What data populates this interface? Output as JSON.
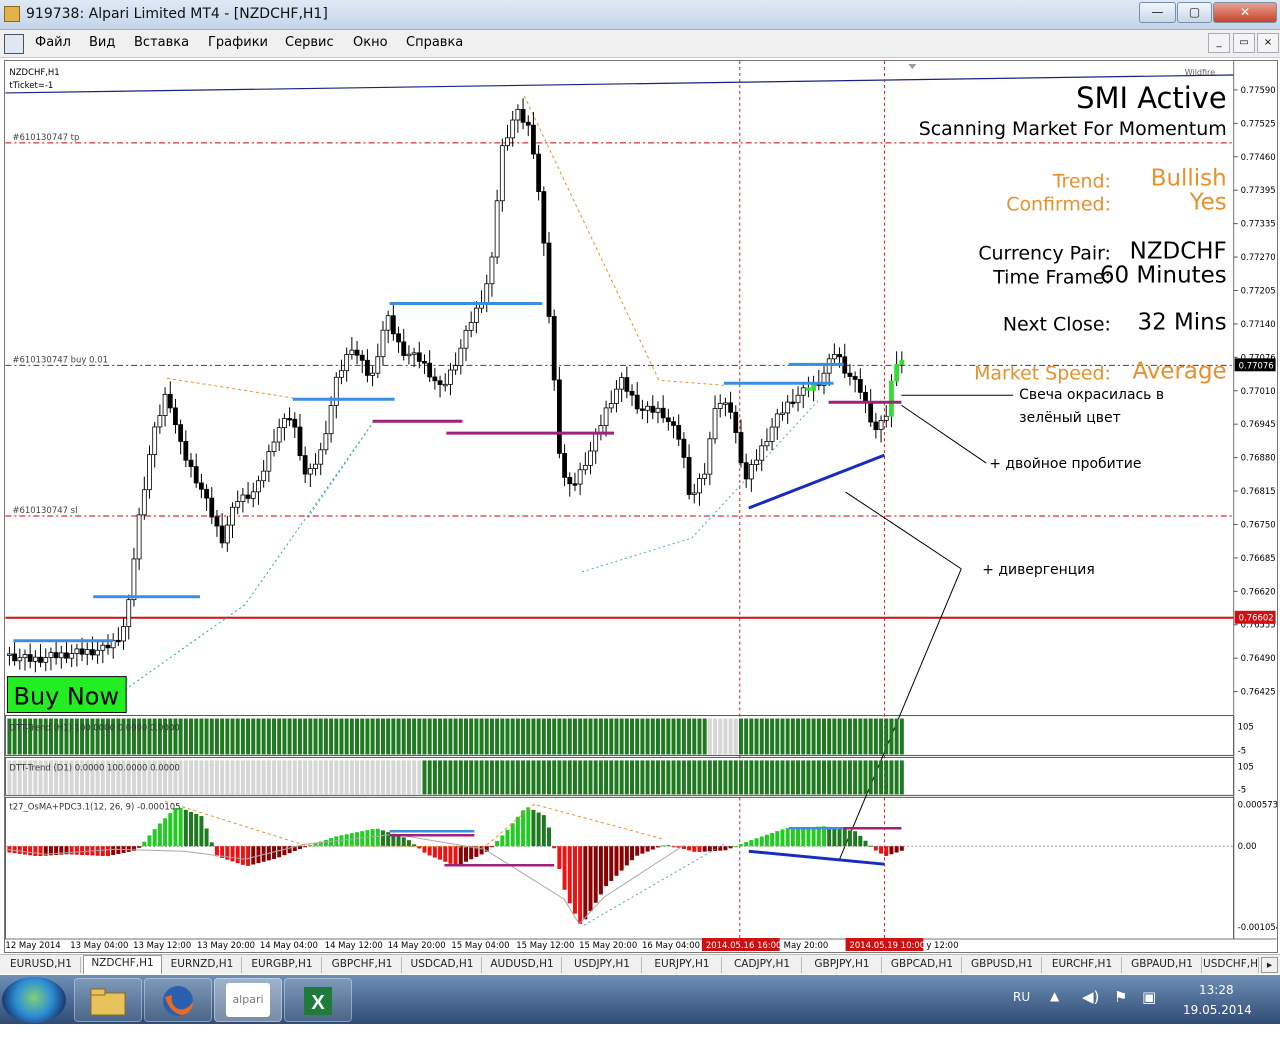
{
  "window": {
    "title": "919738: Alpari Limited MT4 - [NZDCHF,H1]",
    "min": "—",
    "max": "▢",
    "close": "✕"
  },
  "menu": [
    "Файл",
    "Вид",
    "Вставка",
    "Графики",
    "Сервис",
    "Окно",
    "Справка"
  ],
  "mdi": {
    "min": "_",
    "restore": "▭",
    "close": "×"
  },
  "chart": {
    "symbol": "NZDCHF,H1",
    "ticket": "tTicket=-1",
    "wildfire": "Wildfire",
    "lines": {
      "tp": "#610130747 tp",
      "buy": "#610130747 buy 0.01",
      "sl": "#610130747 sl"
    },
    "price_axis": [
      "0.77590",
      "0.77525",
      "0.77460",
      "0.77395",
      "0.77335",
      "0.77270",
      "0.77205",
      "0.77140",
      "0.77076",
      "0.77010",
      "0.76945",
      "0.76880",
      "0.76815",
      "0.76750",
      "0.76685",
      "0.76620",
      "0.76555",
      "0.76490",
      "0.76425"
    ],
    "current_price": "0.77076",
    "level_price": "0.76602",
    "smi": {
      "title": "SMI Active",
      "subtitle": "Scanning Market For Momentum",
      "trend_label": "Trend:",
      "trend_value": "Bullish",
      "confirmed_label": "Confirmed:",
      "confirmed_value": "Yes",
      "pair_label": "Currency Pair:",
      "pair_value": "NZDCHF",
      "tf_label": "Time Frame:",
      "tf_value": "60 Minutes",
      "close_label": "Next Close:",
      "close_value": "32 Mins",
      "speed_label": "Market Speed:",
      "speed_value": "Average"
    },
    "buy_now": "Buy Now",
    "notes": {
      "candle_1": "Свеча окрасилась в",
      "candle_2": "зелёный цвет",
      "double": "+ двойное пробитие",
      "divergence": "+ дивергенция"
    },
    "ind1": {
      "label": "DTT-Trend (H1) 100.0000 0.0000 0.0000",
      "max": "105",
      "min": "-5"
    },
    "ind2": {
      "label": "DTT-Trend (D1) 0.0000 100.0000 0.0000",
      "max": "105",
      "min": "-5"
    },
    "ind3": {
      "label": "t27_OsMA+PDC3.1(12, 26, 9) -0.000105",
      "top": "0.000573",
      "zero": "0.00",
      "bottom": "-0.001054"
    },
    "time_axis": [
      "12 May 2014",
      "13 May 04:00",
      "13 May 12:00",
      "13 May 20:00",
      "14 May 04:00",
      "14 May 12:00",
      "14 May 20:00",
      "15 May 04:00",
      "15 May 12:00",
      "15 May 20:00",
      "16 May 04:00",
      "May 20:00",
      "y 12:00"
    ],
    "time_flags": [
      "2014.05.16 16:00",
      "2014.05.19 10:00"
    ],
    "colors": {
      "blue_level": "#3a8fe0",
      "magenta_level": "#a0207a",
      "red_line": "#d01010",
      "orange_text": "#e8902c",
      "bull_bar": "#1f7a1f",
      "buy_bg": "#22ee22"
    }
  },
  "tabs": [
    "EURUSD,H1",
    "NZDCHF,H1",
    "EURNZD,H1",
    "EURGBP,H1",
    "GBPCHF,H1",
    "USDCAD,H1",
    "AUDUSD,H1",
    "USDJPY,H1",
    "EURJPY,H1",
    "CADJPY,H1",
    "GBPJPY,H1",
    "GBPCAD,H1",
    "GBPUSD,H1",
    "EURCHF,H1",
    "GBPAUD,H1",
    "USDCHF,H"
  ],
  "taskbar": {
    "apps": [
      "explorer",
      "firefox",
      "alpari",
      "excel"
    ],
    "alpari_label": "alpari",
    "lang": "RU",
    "time": "13:28",
    "date": "19.05.2014"
  }
}
